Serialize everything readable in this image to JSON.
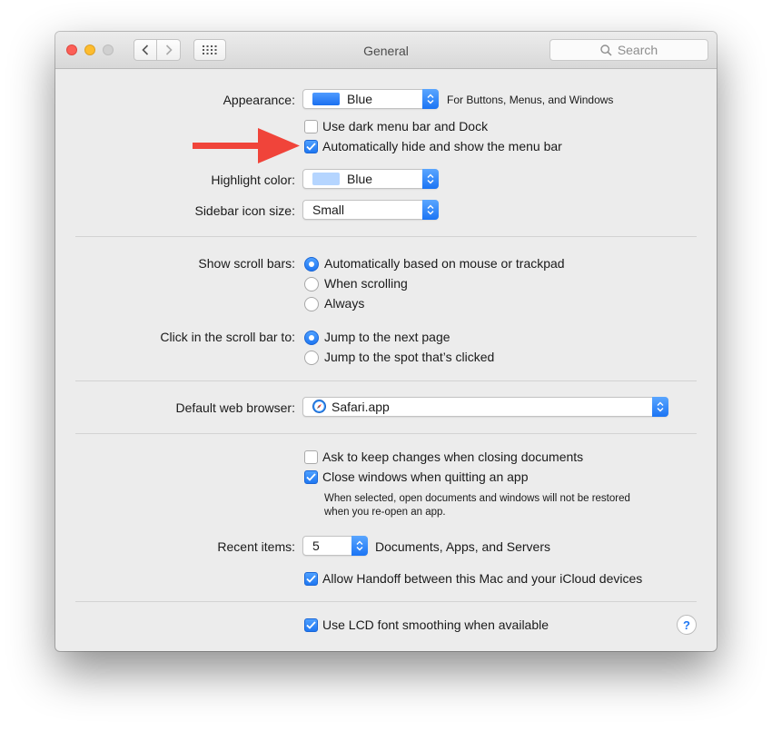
{
  "window": {
    "title": "General"
  },
  "search": {
    "placeholder": "Search"
  },
  "appearance": {
    "label": "Appearance:",
    "value": "Blue",
    "hint": "For Buttons, Menus, and Windows",
    "swatch_color": "#2a7cf0"
  },
  "dark_menu": {
    "label": "Use dark menu bar and Dock",
    "checked": false
  },
  "auto_hide": {
    "label": "Automatically hide and show the menu bar",
    "checked": true
  },
  "highlight": {
    "label": "Highlight color:",
    "value": "Blue",
    "swatch_color": "#b5d5ff"
  },
  "sidebar_icon": {
    "label": "Sidebar icon size:",
    "value": "Small"
  },
  "scroll_bars": {
    "label": "Show scroll bars:",
    "options": [
      "Automatically based on mouse or trackpad",
      "When scrolling",
      "Always"
    ],
    "selected": 0
  },
  "click_scroll": {
    "label": "Click in the scroll bar to:",
    "options": [
      "Jump to the next page",
      "Jump to the spot that’s clicked"
    ],
    "selected": 0
  },
  "browser": {
    "label": "Default web browser:",
    "value": "Safari.app"
  },
  "ask_keep": {
    "label": "Ask to keep changes when closing documents",
    "checked": false
  },
  "close_windows": {
    "label": "Close windows when quitting an app",
    "checked": true,
    "note_line1": "When selected, open documents and windows will not be restored",
    "note_line2": "when you re-open an app."
  },
  "recent": {
    "label": "Recent items:",
    "value": "5",
    "suffix": "Documents, Apps, and Servers"
  },
  "handoff": {
    "label": "Allow Handoff between this Mac and your iCloud devices",
    "checked": true
  },
  "lcd": {
    "label": "Use LCD font smoothing when available",
    "checked": true
  },
  "help": {
    "glyph": "?"
  },
  "annotation": {
    "arrow_color": "#f0443a"
  }
}
